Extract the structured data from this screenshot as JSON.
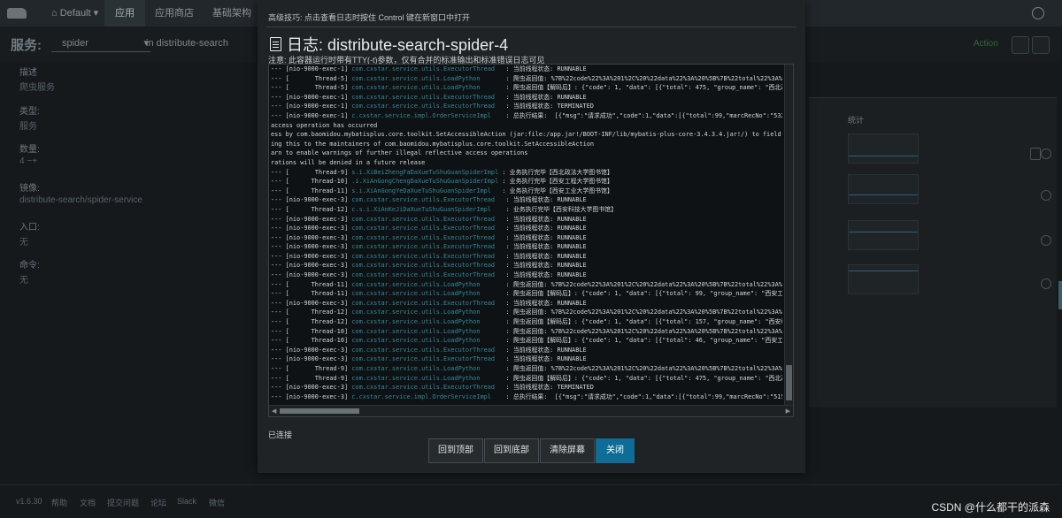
{
  "background": {
    "nav": {
      "env_label": "Default",
      "items": [
        "应用",
        "应用商店",
        "基础架构"
      ]
    },
    "service": {
      "label": "服务:",
      "selected": "spider",
      "in_prefix": "in",
      "stack": "distribute-search",
      "action_label": "Action"
    },
    "details": {
      "desc_label": "描述",
      "desc_value": "爬虫服务",
      "type_label": "类型:",
      "type_value": "服务",
      "count_label": "数量:",
      "count_value": "4",
      "image_label": "镜像:",
      "image_value": "distribute-search/spider-service",
      "entry_label": "入口:",
      "entry_value": "无",
      "cmd_label": "命令:",
      "cmd_value": "无"
    },
    "stats_header": "统计",
    "footer": {
      "version": "v1.6.30",
      "links": [
        "帮助",
        "文档",
        "提交问题",
        "论坛",
        "Slack",
        "微信"
      ]
    },
    "watermark": "CSDN @什么都干的派森"
  },
  "modal": {
    "tip": "高级技巧: 点击查看日志时按住 Control 键在新窗口中打开",
    "title": "日志: distribute-search-spider-4",
    "note": "注意: 此容器运行时带有TTY(-t)参数，仅有合并的标准输出和标准错误日志可见",
    "log_lines": [
      {
        "a": "--- [nio-9000-exec-1] ",
        "c": "com.cxstar.service.utils.ExecutorThread  ",
        "m": " : 当前线程状态: RUNNABLE"
      },
      {
        "a": "--- [       Thread-5] ",
        "c": "com.cxstar.service.utils.LoadPython      ",
        "m": " : 爬虫返回值: %7B%22code%22%3A%201%2C%20%22data%22%3A%20%5B%7B%22total%22%3A%20"
      },
      {
        "a": "--- [       Thread-5] ",
        "c": "com.cxstar.service.utils.LoadPython      ",
        "m": " : 爬虫返回值【解码后】: {\"code\": 1, \"data\": [{\"total\": 475, \"group_name\": \"西北政"
      },
      {
        "a": "--- [nio-9000-exec-1] ",
        "c": "com.cxstar.service.utils.ExecutorThread  ",
        "m": " : 当前线程状态: RUNNABLE"
      },
      {
        "a": "--- [nio-9000-exec-1] ",
        "c": "com.cxstar.service.utils.ExecutorThread  ",
        "m": " : 当前线程状态: TERMINATED"
      },
      {
        "a": "--- [nio-9000-exec-1] ",
        "c": "c.cxstar.service.impl.OrderServiceImpl   ",
        "m": " : 总执行结果:  [{\"msg\":\"请求成功\",\"code\":1,\"data\":[{\"total\":99,\"marcRecNo\":\"532"
      },
      {
        "a": "access operation has occurred",
        "c": "",
        "m": ""
      },
      {
        "a": "ess by com.baomidou.mybatisplus.core.toolkit.SetAccessibleAction (jar:file:/app.jar!/BOOT-INF/lib/mybatis-plus-core-3.4.3.4.jar!/) to field ja",
        "c": "",
        "m": ""
      },
      {
        "a": "ing this to the maintainers of com.baomidou.mybatisplus.core.toolkit.SetAccessibleAction",
        "c": "",
        "m": ""
      },
      {
        "a": "arn to enable warnings of further illegal reflective access operations",
        "c": "",
        "m": ""
      },
      {
        "a": "rations will be denied in a future release",
        "c": "",
        "m": ""
      },
      {
        "a": "--- [       Thread-9] ",
        "c": "s.i.XiBeiZhengFaDaXueTuShuGuanSpiderImpl",
        "m": " : 业务执行完毕【西北政法大学图书馆】"
      },
      {
        "a": "--- [      Thread-10] ",
        "c": ".i.XiAnGongChengDaXueTuShuGuanSpiderImpl",
        "m": " : 业务执行完毕【西安工程大学图书馆】"
      },
      {
        "a": "--- [      Thread-11] ",
        "c": "s.i.XiAnGongYeDaXueTuShuGuanSpiderImpl  ",
        "m": " : 业务执行完毕【西安工业大学图书馆】"
      },
      {
        "a": "--- [nio-9000-exec-3] ",
        "c": "com.cxstar.service.utils.ExecutorThread  ",
        "m": " : 当前线程状态: RUNNABLE"
      },
      {
        "a": "--- [      Thread-12] ",
        "c": "c.s.i.XiAnKeJiDaXueTuShuGuanSpiderImpl   ",
        "m": " : 业务执行完毕【西安科技大学图书馆】"
      },
      {
        "a": "--- [nio-9000-exec-3] ",
        "c": "com.cxstar.service.utils.ExecutorThread  ",
        "m": " : 当前线程状态: RUNNABLE"
      },
      {
        "a": "--- [nio-9000-exec-3] ",
        "c": "com.cxstar.service.utils.ExecutorThread  ",
        "m": " : 当前线程状态: RUNNABLE"
      },
      {
        "a": "--- [nio-9000-exec-3] ",
        "c": "com.cxstar.service.utils.ExecutorThread  ",
        "m": " : 当前线程状态: RUNNABLE"
      },
      {
        "a": "--- [nio-9000-exec-3] ",
        "c": "com.cxstar.service.utils.ExecutorThread  ",
        "m": " : 当前线程状态: RUNNABLE"
      },
      {
        "a": "--- [nio-9000-exec-3] ",
        "c": "com.cxstar.service.utils.ExecutorThread  ",
        "m": " : 当前线程状态: RUNNABLE"
      },
      {
        "a": "--- [nio-9000-exec-3] ",
        "c": "com.cxstar.service.utils.ExecutorThread  ",
        "m": " : 当前线程状态: RUNNABLE"
      },
      {
        "a": "--- [nio-9000-exec-3] ",
        "c": "com.cxstar.service.utils.ExecutorThread  ",
        "m": " : 当前线程状态: RUNNABLE"
      },
      {
        "a": "--- [      Thread-11] ",
        "c": "com.cxstar.service.utils.LoadPython      ",
        "m": " : 爬虫返回值: %7B%22code%22%3A%201%2C%20%22data%22%3A%20%5B%7B%22total%22%3A%20"
      },
      {
        "a": "--- [      Thread-11] ",
        "c": "com.cxstar.service.utils.LoadPython      ",
        "m": " : 爬虫返回值【解码后】: {\"code\": 1, \"data\": [{\"total\": 99, \"group_name\": \"西安工"
      },
      {
        "a": "--- [nio-9000-exec-3] ",
        "c": "com.cxstar.service.utils.ExecutorThread  ",
        "m": " : 当前线程状态: RUNNABLE"
      },
      {
        "a": "--- [      Thread-12] ",
        "c": "com.cxstar.service.utils.LoadPython      ",
        "m": " : 爬虫返回值: %7B%22code%22%3A%201%2C%20%22data%22%3A%20%5B%7B%22total%22%3A%20"
      },
      {
        "a": "--- [      Thread-12] ",
        "c": "com.cxstar.service.utils.LoadPython      ",
        "m": " : 爬虫返回值【解码后】: {\"code\": 1, \"data\": [{\"total\": 157, \"group_name\": \"西安科"
      },
      {
        "a": "--- [      Thread-10] ",
        "c": "com.cxstar.service.utils.LoadPython      ",
        "m": " : 爬虫返回值: %7B%22code%22%3A%201%2C%20%22data%22%3A%20%5B%7B%22total%22%3A%20"
      },
      {
        "a": "--- [      Thread-10] ",
        "c": "com.cxstar.service.utils.LoadPython      ",
        "m": " : 爬虫返回值【解码后】: {\"code\": 1, \"data\": [{\"total\": 46, \"group_name\": \"西安工"
      },
      {
        "a": "--- [nio-9000-exec-3] ",
        "c": "com.cxstar.service.utils.ExecutorThread  ",
        "m": " : 当前线程状态: RUNNABLE"
      },
      {
        "a": "--- [nio-9000-exec-3] ",
        "c": "com.cxstar.service.utils.ExecutorThread  ",
        "m": " : 当前线程状态: RUNNABLE"
      },
      {
        "a": "--- [       Thread-9] ",
        "c": "com.cxstar.service.utils.LoadPython      ",
        "m": " : 爬虫返回值: %7B%22code%22%3A%201%2C%20%22data%22%3A%20%5B%7B%22total%22%3A%20"
      },
      {
        "a": "--- [       Thread-9] ",
        "c": "com.cxstar.service.utils.LoadPython      ",
        "m": " : 爬虫返回值【解码后】: {\"code\": 1, \"data\": [{\"total\": 475, \"group_name\": \"西北政"
      },
      {
        "a": "--- [nio-9000-exec-3] ",
        "c": "com.cxstar.service.utils.ExecutorThread  ",
        "m": " : 当前线程状态: TERMINATED"
      },
      {
        "a": "--- [nio-9000-exec-3] ",
        "c": "c.cxstar.service.impl.OrderServiceImpl   ",
        "m": " : 总执行结果:  [{\"msg\":\"请求成功\",\"code\":1,\"data\":[{\"total\":99,\"marcRecNo\":\"515"
      }
    ],
    "status": "已连接",
    "buttons": {
      "top": "回到顶部",
      "bottom": "回到底部",
      "clear": "清除屏幕",
      "close": "关闭"
    },
    "colors": {
      "primary": "#0e6c97",
      "class_name": "#2f8a99"
    }
  }
}
